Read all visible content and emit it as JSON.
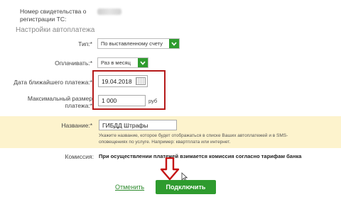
{
  "form": {
    "cert_label": "Номер свидетельства о регистрации ТС:",
    "section_title": "Настройки автоплатежа",
    "type": {
      "label": "Тип:*",
      "value": "По выставленному счету"
    },
    "pay": {
      "label": "Оплачивать:*",
      "value": "Раз в месяц"
    },
    "date": {
      "label": "Дата ближайшего платежа:*",
      "value": "19.04.2018"
    },
    "max": {
      "label": "Максимальный размер платежа:*",
      "value": "1 000",
      "unit": "руб"
    },
    "name": {
      "label": "Название:*",
      "value": "ГИБДД Штрафы",
      "hint": "Укажите название, которое будет отображаться в списке Ваших автоплатежей и в SMS-оповещениях по услуге. Например: квартплата или интернет."
    },
    "commission": {
      "label": "Комиссия:",
      "text": "При осуществлении платежей взимается комиссия согласно тарифам банка"
    }
  },
  "actions": {
    "cancel": "Отменить",
    "connect": "Подключить"
  },
  "colors": {
    "accent": "#2e9b2e",
    "highlight": "#b51a1a",
    "name_bg": "#fdf3cd"
  }
}
